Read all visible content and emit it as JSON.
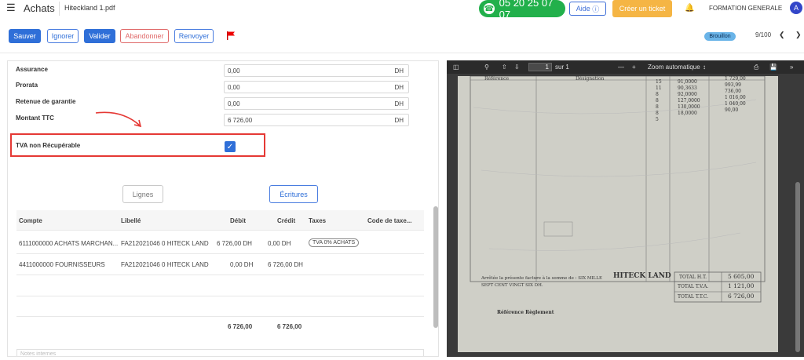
{
  "header": {
    "title": "Achats",
    "filename": "Hiteckland 1.pdf",
    "phone": "05 20 25 07 07",
    "help_label": "Aide",
    "ticket_label": "Créer un ticket",
    "org": "FORMATION GENERALE",
    "avatar_letter": "A"
  },
  "toolbar": {
    "save": "Sauver",
    "ignore": "Ignorer",
    "validate": "Valider",
    "abandon": "Abandonner",
    "resend": "Renvoyer",
    "status_badge": "Brouillon",
    "pager": "9/100"
  },
  "form": {
    "assurance_label": "Assurance",
    "assurance_value": "0,00",
    "prorata_label": "Prorata",
    "prorata_value": "0,00",
    "retenue_label": "Retenue de garantie",
    "retenue_value": "0,00",
    "ttc_label": "Montant TTC",
    "ttc_value": "6 726,00",
    "currency": "DH",
    "tva_label": "TVA non Récupérable",
    "tva_checked": true
  },
  "tabs": {
    "lignes": "Lignes",
    "ecritures": "Écritures"
  },
  "table": {
    "headers": [
      "Compte",
      "Libellé",
      "Débit",
      "Crédit",
      "Taxes",
      "Code de taxe..."
    ],
    "rows": [
      {
        "compte": "6111000000 ACHATS MARCHAN...",
        "libelle": "FA212021046 0 HITECK LAND",
        "debit": "6 726,00 DH",
        "credit": "0,00 DH",
        "taxes": "TVA 0% ACHATS"
      },
      {
        "compte": "4411000000 FOURNISSEURS",
        "libelle": "FA212021046 0 HITECK LAND",
        "debit": "0,00 DH",
        "credit": "6 726,00 DH",
        "taxes": ""
      }
    ],
    "total_debit": "6 726,00",
    "total_credit": "6 726,00"
  },
  "notes_placeholder": "Notes internes",
  "pdf": {
    "page_current": "1",
    "page_total": "sur 1",
    "zoom": "Zoom automatique",
    "invoice": {
      "col_ref": "Référence",
      "col_designation": "Désignation",
      "quantities": [
        "15",
        "11",
        "8",
        "8",
        "8",
        "8",
        "5"
      ],
      "prices": [
        "91,0000",
        "90,3633",
        "92,0000",
        "127,0000",
        "130,0000",
        "18,0000"
      ],
      "amounts": [
        "1 729,00",
        "993,99",
        "736,00",
        "1 016,00",
        "1 040,00",
        "90,00"
      ],
      "stamp": "HITECK LAND",
      "footer_text": "Arrêtée la présente facture à la somme de : SIX MILLE SEPT CENT VINGT SIX DH.",
      "reglement": "Référence Règlement",
      "total_ht_label": "TOTAL H.T.",
      "total_ht": "5 605,00",
      "total_tva_label": "TOTAL T.V.A.",
      "total_tva": "1 121,00",
      "total_ttc_label": "TOTAL T.T.C.",
      "total_ttc": "6 726,00"
    }
  }
}
